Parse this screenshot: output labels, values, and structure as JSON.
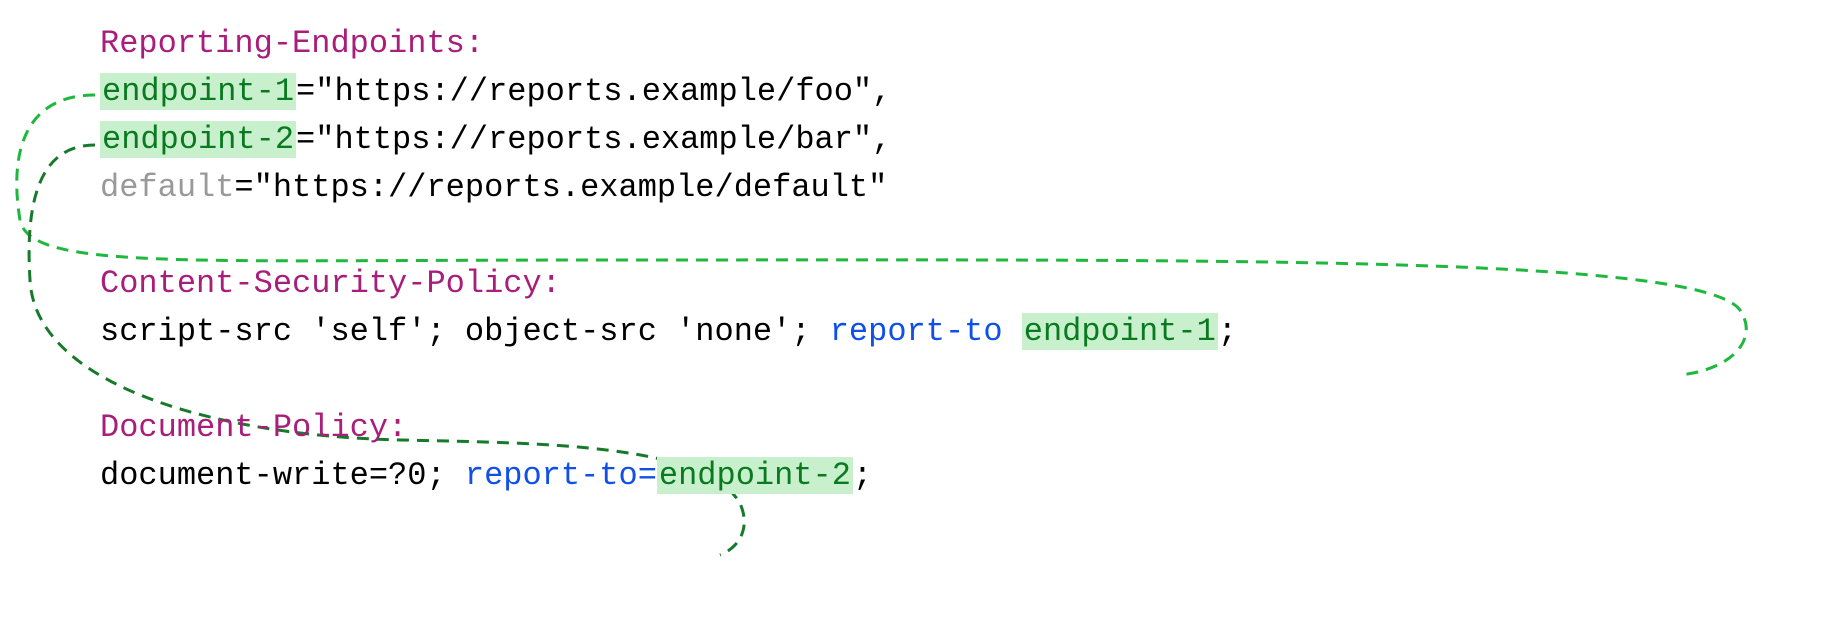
{
  "reportingEndpoints": {
    "headerName": "Reporting-Endpoints:",
    "endpoints": [
      {
        "name": "endpoint-1",
        "url": "\"https://reports.example/foo\"",
        "suffix": ","
      },
      {
        "name": "endpoint-2",
        "url": "\"https://reports.example/bar\"",
        "suffix": ","
      },
      {
        "name": "default",
        "url": "\"https://reports.example/default\"",
        "suffix": ""
      }
    ]
  },
  "csp": {
    "headerName": "Content-Security-Policy:",
    "directiveText": "script-src 'self'; object-src 'none'; ",
    "reportToKeyword": "report-to",
    "space": " ",
    "endpointRef": "endpoint-1",
    "terminator": ";"
  },
  "docPolicy": {
    "headerName": "Document-Policy:",
    "directiveText": "document-write=?0; ",
    "reportToKeyword": "report-to=",
    "endpointRef": "endpoint-2",
    "terminator": ";"
  },
  "equals": "="
}
